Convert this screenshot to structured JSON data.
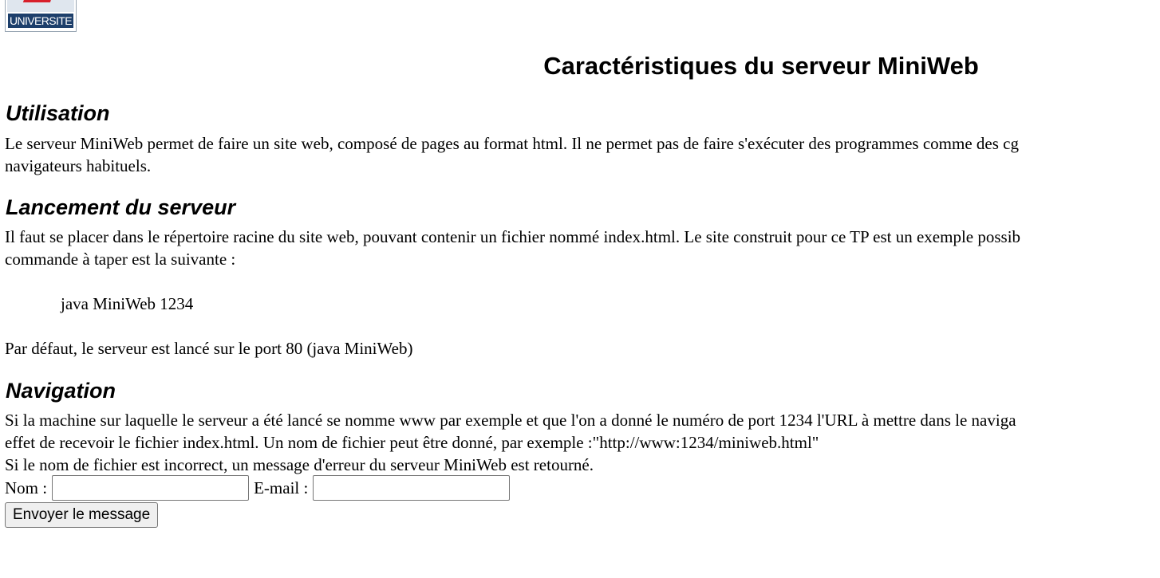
{
  "logo": {
    "text": "UNIVERSITE"
  },
  "title": "Caractéristiques du serveur MiniWeb",
  "sections": {
    "utilisation": {
      "heading": "Utilisation",
      "line1": "Le serveur MiniWeb permet de faire un site web, composé de pages au format html. Il ne permet pas de faire s'exécuter des programmes comme des cg",
      "line2": "navigateurs habituels."
    },
    "lancement": {
      "heading": "Lancement du serveur",
      "line1": "Il faut se placer dans le répertoire racine du site web, pouvant contenir un fichier nommé index.html. Le site construit pour ce TP est un exemple possib",
      "line2": "commande à taper est la suivante :",
      "command": "java MiniWeb 1234",
      "default_note": "Par défaut, le serveur est lancé sur le port 80 (java MiniWeb)"
    },
    "navigation": {
      "heading": "Navigation",
      "line1": "Si la machine sur laquelle le serveur a été lancé se nomme www par exemple et que l'on a donné le numéro de port 1234 l'URL à mettre dans le naviga",
      "line2": "effet de recevoir le fichier index.html. Un nom de fichier peut être donné, par exemple :\"http://www:1234/miniweb.html\"",
      "line3": "Si le nom de fichier est incorrect, un message d'erreur du serveur MiniWeb est retourné."
    }
  },
  "form": {
    "nom_label": "Nom :",
    "nom_value": "",
    "email_label": "E-mail :",
    "email_value": "",
    "submit_label": "Envoyer le message"
  }
}
